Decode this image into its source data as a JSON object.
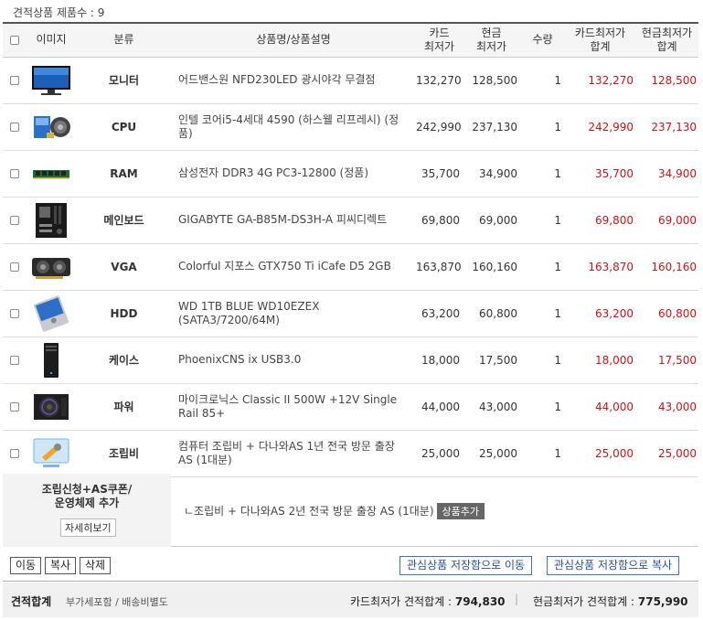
{
  "count_label": "견적상품 제품수 : 9",
  "headers": {
    "image": "이미지",
    "category": "분류",
    "name": "상품명/상품설명",
    "card_min": [
      "카드",
      "최저가"
    ],
    "cash_min": [
      "현금",
      "최저가"
    ],
    "qty": "수량",
    "card_total": [
      "카드최저가",
      "합계"
    ],
    "cash_total": [
      "현금최저가",
      "합계"
    ]
  },
  "items": [
    {
      "category": "모니터",
      "name": "어드밴스원 NFD230LED 광시야각 무결점",
      "card": "132,270",
      "cash": "128,500",
      "qty": "1",
      "card_total": "132,270",
      "cash_total": "128,500",
      "icon": "monitor-icon"
    },
    {
      "category": "CPU",
      "name": "인텔 코어i5-4세대 4590 (하스웰 리프레시) (정품)",
      "card": "242,990",
      "cash": "237,130",
      "qty": "1",
      "card_total": "242,990",
      "cash_total": "237,130",
      "icon": "cpu-icon"
    },
    {
      "category": "RAM",
      "name": "삼성전자 DDR3 4G PC3-12800 (정품)",
      "card": "35,700",
      "cash": "34,900",
      "qty": "1",
      "card_total": "35,700",
      "cash_total": "34,900",
      "icon": "ram-icon"
    },
    {
      "category": "메인보드",
      "name": "GIGABYTE GA-B85M-DS3H-A 피씨디렉트",
      "card": "69,800",
      "cash": "69,000",
      "qty": "1",
      "card_total": "69,800",
      "cash_total": "69,000",
      "icon": "motherboard-icon"
    },
    {
      "category": "VGA",
      "name": "Colorful 지포스 GTX750 Ti iCafe D5 2GB",
      "card": "163,870",
      "cash": "160,160",
      "qty": "1",
      "card_total": "163,870",
      "cash_total": "160,160",
      "icon": "vga-icon"
    },
    {
      "category": "HDD",
      "name": "WD 1TB BLUE WD10EZEX (SATA3/7200/64M)",
      "card": "63,200",
      "cash": "60,800",
      "qty": "1",
      "card_total": "63,200",
      "cash_total": "60,800",
      "icon": "hdd-icon"
    },
    {
      "category": "케이스",
      "name": "PhoenixCNS ix USB3.0",
      "card": "18,000",
      "cash": "17,500",
      "qty": "1",
      "card_total": "18,000",
      "cash_total": "17,500",
      "icon": "case-icon"
    },
    {
      "category": "파워",
      "name": "마이크로닉스 Classic II 500W +12V Single Rail 85+",
      "card": "44,000",
      "cash": "43,000",
      "qty": "1",
      "card_total": "44,000",
      "cash_total": "43,000",
      "icon": "psu-icon"
    },
    {
      "category": "조립비",
      "name": "컴퓨터 조립비 + 다나와AS 1년 전국 방문 출장 AS (1대분)",
      "card": "25,000",
      "cash": "25,000",
      "qty": "1",
      "card_total": "25,000",
      "cash_total": "25,000",
      "icon": "assembly-icon"
    }
  ],
  "assembly": {
    "title_line1": "조립신청+AS쿠폰/",
    "title_line2": "운영체제 추가",
    "detail_button": "자세히보기",
    "option_text": "ㄴ조립비 + 다나와AS 2년 전국 방문 출장 AS (1대분)",
    "add_button": "상품추가"
  },
  "actions": {
    "move": "이동",
    "copy": "복사",
    "delete": "삭제",
    "save_move": "관심상품 저장함으로 이동",
    "save_copy": "관심상품 저장함으로 복사"
  },
  "total": {
    "label": "견적합계",
    "note": "부가세포함 / 배송비별도",
    "card_label": "카드최저가 견적합계 :",
    "card_value": "794,830",
    "separator": "|",
    "cash_label": "현금최저가 견적합계 :",
    "cash_value": "775,990"
  },
  "colors": {
    "price_total": "#c0161b",
    "button_blue": "#2b4d94",
    "header_bg": "#f5f5f5"
  }
}
